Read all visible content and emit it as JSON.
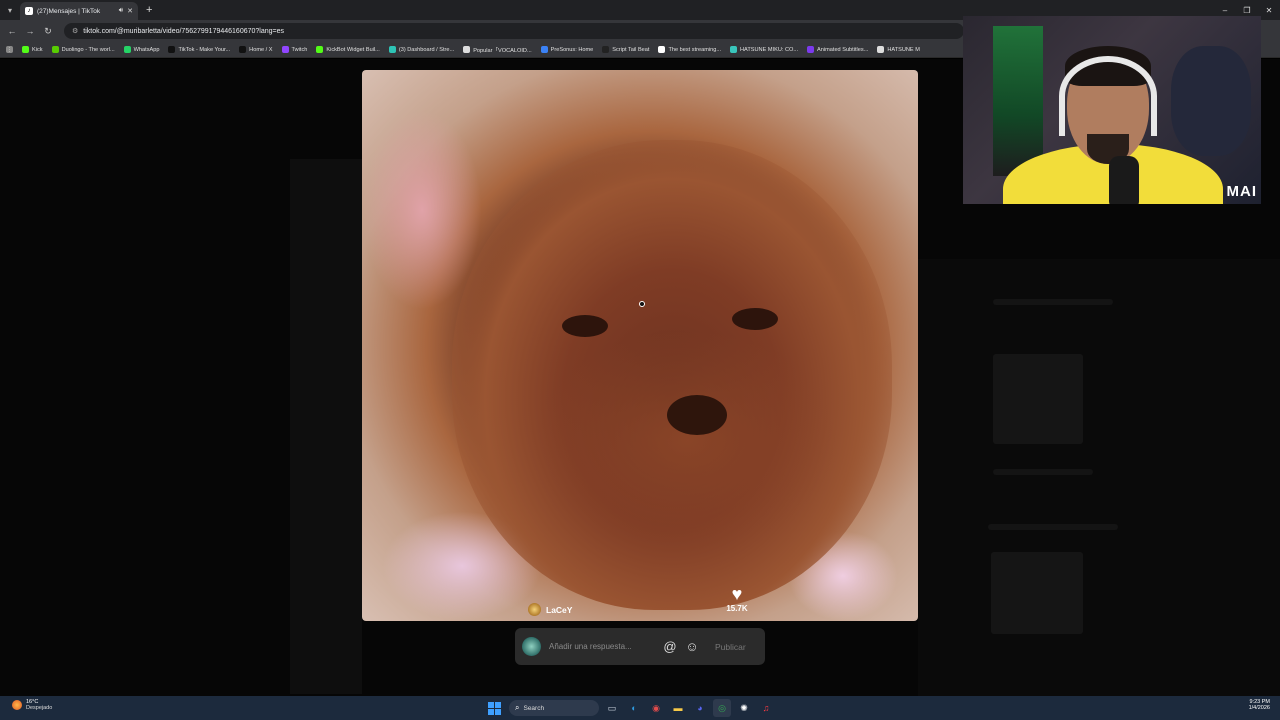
{
  "browser": {
    "tab_title": "(27)Mensajes | TikTok",
    "url": "tiktok.com/@muribarletta/video/7562799179446160670?lang=es",
    "new_tab": "+",
    "window_controls": [
      "–",
      "❐",
      "✕"
    ]
  },
  "bookmarks": [
    {
      "label": "Kick",
      "icon": "kick-icon",
      "color": "#53fc18"
    },
    {
      "label": "Duolingo - The worl...",
      "icon": "duolingo-icon",
      "color": "#58cc02"
    },
    {
      "label": "WhatsApp",
      "icon": "whatsapp-icon",
      "color": "#25d366"
    },
    {
      "label": "TikTok - Make Your...",
      "icon": "tiktok-icon",
      "color": "#111111"
    },
    {
      "label": "Home / X",
      "icon": "x-icon",
      "color": "#111111"
    },
    {
      "label": "Twitch",
      "icon": "twitch-icon",
      "color": "#9146ff"
    },
    {
      "label": "KickBot Widget Buil...",
      "icon": "kickbot-icon",
      "color": "#53fc18"
    },
    {
      "label": "(3) Dashboard / Stre...",
      "icon": "dashboard-icon",
      "color": "#2ec4b6"
    },
    {
      "label": "Popular「VOCALOID...",
      "icon": "vocaloid-icon",
      "color": "#dddddd"
    },
    {
      "label": "PreSonus: Home",
      "icon": "presonus-icon",
      "color": "#3b82f6"
    },
    {
      "label": "Script Tail Beat",
      "icon": "script-icon",
      "color": "#222222"
    },
    {
      "label": "The best streaming...",
      "icon": "streaming-icon",
      "color": "#ffffff"
    },
    {
      "label": "HATSUNE MIKU: CO...",
      "icon": "miku-icon",
      "color": "#39c5bb"
    },
    {
      "label": "Animated Subtitles...",
      "icon": "subtitles-icon",
      "color": "#7c3aed"
    },
    {
      "label": "HATSUNE M",
      "icon": "miku-icon",
      "color": "#dddddd"
    }
  ],
  "video": {
    "author": "LaCeY",
    "likes": "15.7K"
  },
  "reply": {
    "placeholder": "Añadir una respuesta...",
    "mention_icon": "@",
    "emoji_icon": "☺",
    "publish_label": "Publicar"
  },
  "webcam": {
    "brand": "MAI"
  },
  "taskbar": {
    "temperature": "16°C",
    "condition": "Despejado",
    "search_label": "Search",
    "time": "9:23 PM",
    "date": "1/4/2026",
    "apps": [
      {
        "name": "task-view-icon",
        "glyph": "▭",
        "color": "#cfd8e3"
      },
      {
        "name": "edge-icon",
        "glyph": "◐",
        "color": "#2f9be0"
      },
      {
        "name": "chrome-dev-icon",
        "glyph": "◉",
        "color": "#e34c4c"
      },
      {
        "name": "file-explorer-icon",
        "glyph": "▬",
        "color": "#f7c948"
      },
      {
        "name": "discord-icon",
        "glyph": "◕",
        "color": "#5865f2"
      },
      {
        "name": "chrome-icon",
        "glyph": "◎",
        "color": "#34a853"
      },
      {
        "name": "chatgpt-icon",
        "glyph": "✺",
        "color": "#ffffff"
      },
      {
        "name": "itunes-icon",
        "glyph": "♫",
        "color": "#fc3c44"
      }
    ]
  }
}
